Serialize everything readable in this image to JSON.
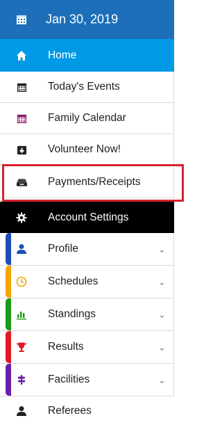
{
  "header": {
    "date": "Jan 30, 2019"
  },
  "menu": {
    "home": "Home",
    "todays_events": "Today's Events",
    "family_calendar": "Family Calendar",
    "volunteer_now": "Volunteer Now!",
    "payments_receipts": "Payments/Receipts",
    "account_settings": "Account Settings",
    "profile": "Profile",
    "schedules": "Schedules",
    "standings": "Standings",
    "results": "Results",
    "facilities": "Facilities",
    "referees": "Referees",
    "chevron": "⌄"
  },
  "icons": {
    "calendar": "calendar-icon",
    "home": "home-icon",
    "events": "events-calendar-icon",
    "family": "family-calendar-icon",
    "volunteer": "download-box-icon",
    "payments": "drawer-icon",
    "settings": "gear-icon",
    "profile": "user-icon",
    "schedules": "clock-icon",
    "standings": "bar-chart-icon",
    "results": "trophy-icon",
    "facilities": "signpost-icon",
    "referees": "user-icon"
  },
  "colors": {
    "header_bg": "#1c6fb8",
    "home_bg": "#0099e6",
    "account_bg": "#000000",
    "profile_accent": "#1f4db8",
    "schedules_accent": "#f5a400",
    "standings_accent": "#1a9a1a",
    "results_accent": "#e01b24",
    "facilities_accent": "#6a1fa8",
    "highlight": "#d6222c"
  }
}
